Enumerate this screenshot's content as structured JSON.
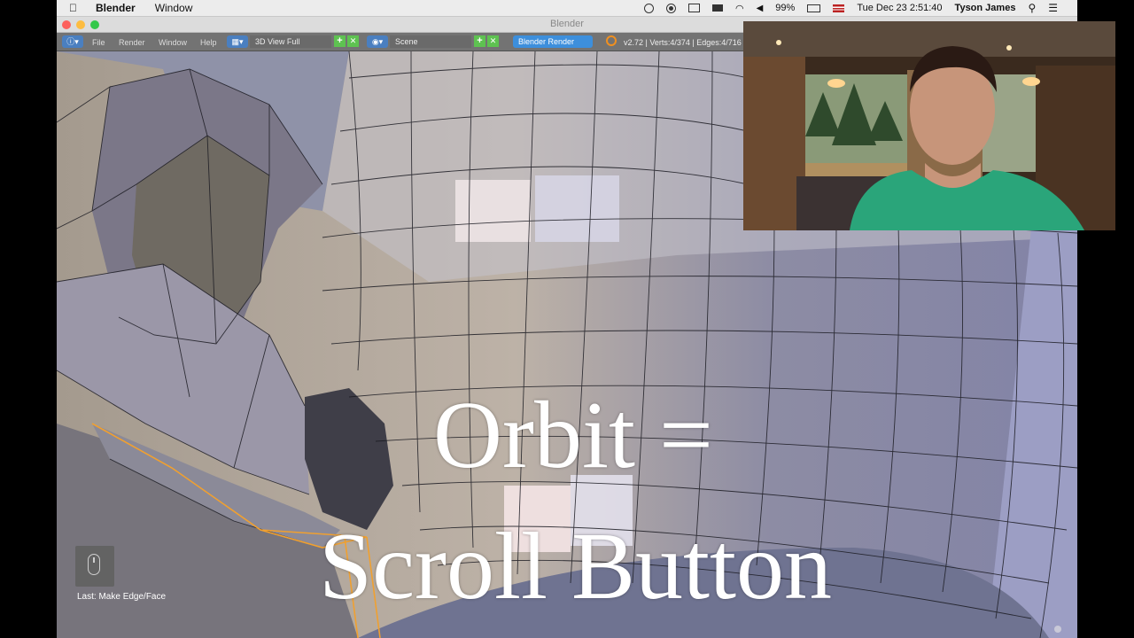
{
  "menubar": {
    "apple_icon": "apple-icon",
    "app_name": "Blender",
    "menus": [
      "Window"
    ],
    "battery": "99%",
    "datetime": "Tue Dec 23  2:51:40",
    "user": "Tyson James"
  },
  "window": {
    "title": "Blender"
  },
  "header": {
    "menus": [
      "File",
      "Render",
      "Window",
      "Help"
    ],
    "screen_layout": "3D View Full",
    "scene": "Scene",
    "render_engine": "Blender Render",
    "stats": "v2.72 | Verts:4/374 | Edges:4/716"
  },
  "viewport": {
    "overlay_line1": "Orbit =",
    "overlay_line2": "Scroll Button",
    "last_operator": "Last: Make Edge/Face"
  },
  "colors": {
    "menubar_bg": "#ececec",
    "header_bg": "#737373",
    "accent_blue": "#3d8fdc",
    "add_green": "#5ec251",
    "selection_orange": "#f0a030"
  }
}
